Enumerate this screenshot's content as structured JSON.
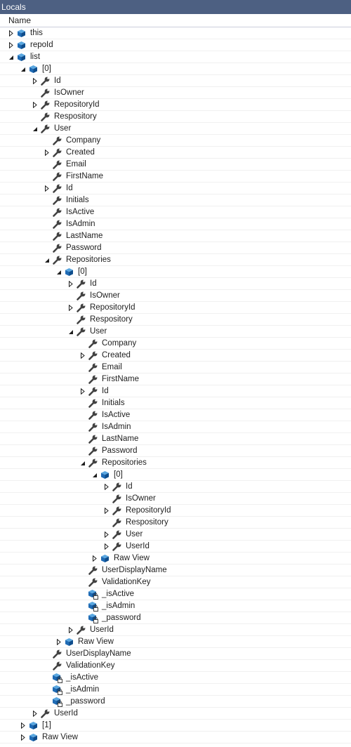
{
  "window": {
    "title": "Locals"
  },
  "columns": {
    "name": "Name"
  },
  "rows": [
    {
      "d": 0,
      "e": "c",
      "i": "obj",
      "t": "this"
    },
    {
      "d": 0,
      "e": "c",
      "i": "obj",
      "t": "repoId"
    },
    {
      "d": 0,
      "e": "o",
      "i": "obj",
      "t": "list"
    },
    {
      "d": 1,
      "e": "o",
      "i": "obj",
      "t": "[0]"
    },
    {
      "d": 2,
      "e": "c",
      "i": "wrench",
      "t": "Id"
    },
    {
      "d": 2,
      "e": "",
      "i": "wrench",
      "t": "IsOwner"
    },
    {
      "d": 2,
      "e": "c",
      "i": "wrench",
      "t": "RepositoryId"
    },
    {
      "d": 2,
      "e": "",
      "i": "wrench",
      "t": "Respository"
    },
    {
      "d": 2,
      "e": "o",
      "i": "wrench",
      "t": "User"
    },
    {
      "d": 3,
      "e": "",
      "i": "wrench",
      "t": "Company"
    },
    {
      "d": 3,
      "e": "c",
      "i": "wrench",
      "t": "Created"
    },
    {
      "d": 3,
      "e": "",
      "i": "wrench",
      "t": "Email"
    },
    {
      "d": 3,
      "e": "",
      "i": "wrench",
      "t": "FirstName"
    },
    {
      "d": 3,
      "e": "c",
      "i": "wrench",
      "t": "Id"
    },
    {
      "d": 3,
      "e": "",
      "i": "wrench",
      "t": "Initials"
    },
    {
      "d": 3,
      "e": "",
      "i": "wrench",
      "t": "IsActive"
    },
    {
      "d": 3,
      "e": "",
      "i": "wrench",
      "t": "IsAdmin"
    },
    {
      "d": 3,
      "e": "",
      "i": "wrench",
      "t": "LastName"
    },
    {
      "d": 3,
      "e": "",
      "i": "wrench",
      "t": "Password"
    },
    {
      "d": 3,
      "e": "o",
      "i": "wrench",
      "t": "Repositories"
    },
    {
      "d": 4,
      "e": "o",
      "i": "obj",
      "t": "[0]"
    },
    {
      "d": 5,
      "e": "c",
      "i": "wrench",
      "t": "Id"
    },
    {
      "d": 5,
      "e": "",
      "i": "wrench",
      "t": "IsOwner"
    },
    {
      "d": 5,
      "e": "c",
      "i": "wrench",
      "t": "RepositoryId"
    },
    {
      "d": 5,
      "e": "",
      "i": "wrench",
      "t": "Respository"
    },
    {
      "d": 5,
      "e": "o",
      "i": "wrench",
      "t": "User"
    },
    {
      "d": 6,
      "e": "",
      "i": "wrench",
      "t": "Company"
    },
    {
      "d": 6,
      "e": "c",
      "i": "wrench",
      "t": "Created"
    },
    {
      "d": 6,
      "e": "",
      "i": "wrench",
      "t": "Email"
    },
    {
      "d": 6,
      "e": "",
      "i": "wrench",
      "t": "FirstName"
    },
    {
      "d": 6,
      "e": "c",
      "i": "wrench",
      "t": "Id"
    },
    {
      "d": 6,
      "e": "",
      "i": "wrench",
      "t": "Initials"
    },
    {
      "d": 6,
      "e": "",
      "i": "wrench",
      "t": "IsActive"
    },
    {
      "d": 6,
      "e": "",
      "i": "wrench",
      "t": "IsAdmin"
    },
    {
      "d": 6,
      "e": "",
      "i": "wrench",
      "t": "LastName"
    },
    {
      "d": 6,
      "e": "",
      "i": "wrench",
      "t": "Password"
    },
    {
      "d": 6,
      "e": "o",
      "i": "wrench",
      "t": "Repositories"
    },
    {
      "d": 7,
      "e": "o",
      "i": "obj",
      "t": "[0]"
    },
    {
      "d": 8,
      "e": "c",
      "i": "wrench",
      "t": "Id"
    },
    {
      "d": 8,
      "e": "",
      "i": "wrench",
      "t": "IsOwner"
    },
    {
      "d": 8,
      "e": "c",
      "i": "wrench",
      "t": "RepositoryId"
    },
    {
      "d": 8,
      "e": "",
      "i": "wrench",
      "t": "Respository"
    },
    {
      "d": 8,
      "e": "c",
      "i": "wrench",
      "t": "User"
    },
    {
      "d": 8,
      "e": "c",
      "i": "wrench",
      "t": "UserId"
    },
    {
      "d": 7,
      "e": "c",
      "i": "obj",
      "t": "Raw View"
    },
    {
      "d": 6,
      "e": "",
      "i": "wrench",
      "t": "UserDisplayName"
    },
    {
      "d": 6,
      "e": "",
      "i": "wrench",
      "t": "ValidationKey"
    },
    {
      "d": 6,
      "e": "",
      "i": "objlock",
      "t": "_isActive"
    },
    {
      "d": 6,
      "e": "",
      "i": "objlock",
      "t": "_isAdmin"
    },
    {
      "d": 6,
      "e": "",
      "i": "objlock",
      "t": "_password"
    },
    {
      "d": 5,
      "e": "c",
      "i": "wrench",
      "t": "UserId"
    },
    {
      "d": 4,
      "e": "c",
      "i": "obj",
      "t": "Raw View"
    },
    {
      "d": 3,
      "e": "",
      "i": "wrench",
      "t": "UserDisplayName"
    },
    {
      "d": 3,
      "e": "",
      "i": "wrench",
      "t": "ValidationKey"
    },
    {
      "d": 3,
      "e": "",
      "i": "objlock",
      "t": "_isActive"
    },
    {
      "d": 3,
      "e": "",
      "i": "objlock",
      "t": "_isAdmin"
    },
    {
      "d": 3,
      "e": "",
      "i": "objlock",
      "t": "_password"
    },
    {
      "d": 2,
      "e": "c",
      "i": "wrench",
      "t": "UserId"
    },
    {
      "d": 1,
      "e": "c",
      "i": "obj",
      "t": "[1]"
    },
    {
      "d": 1,
      "e": "c",
      "i": "obj",
      "t": "Raw View"
    }
  ]
}
